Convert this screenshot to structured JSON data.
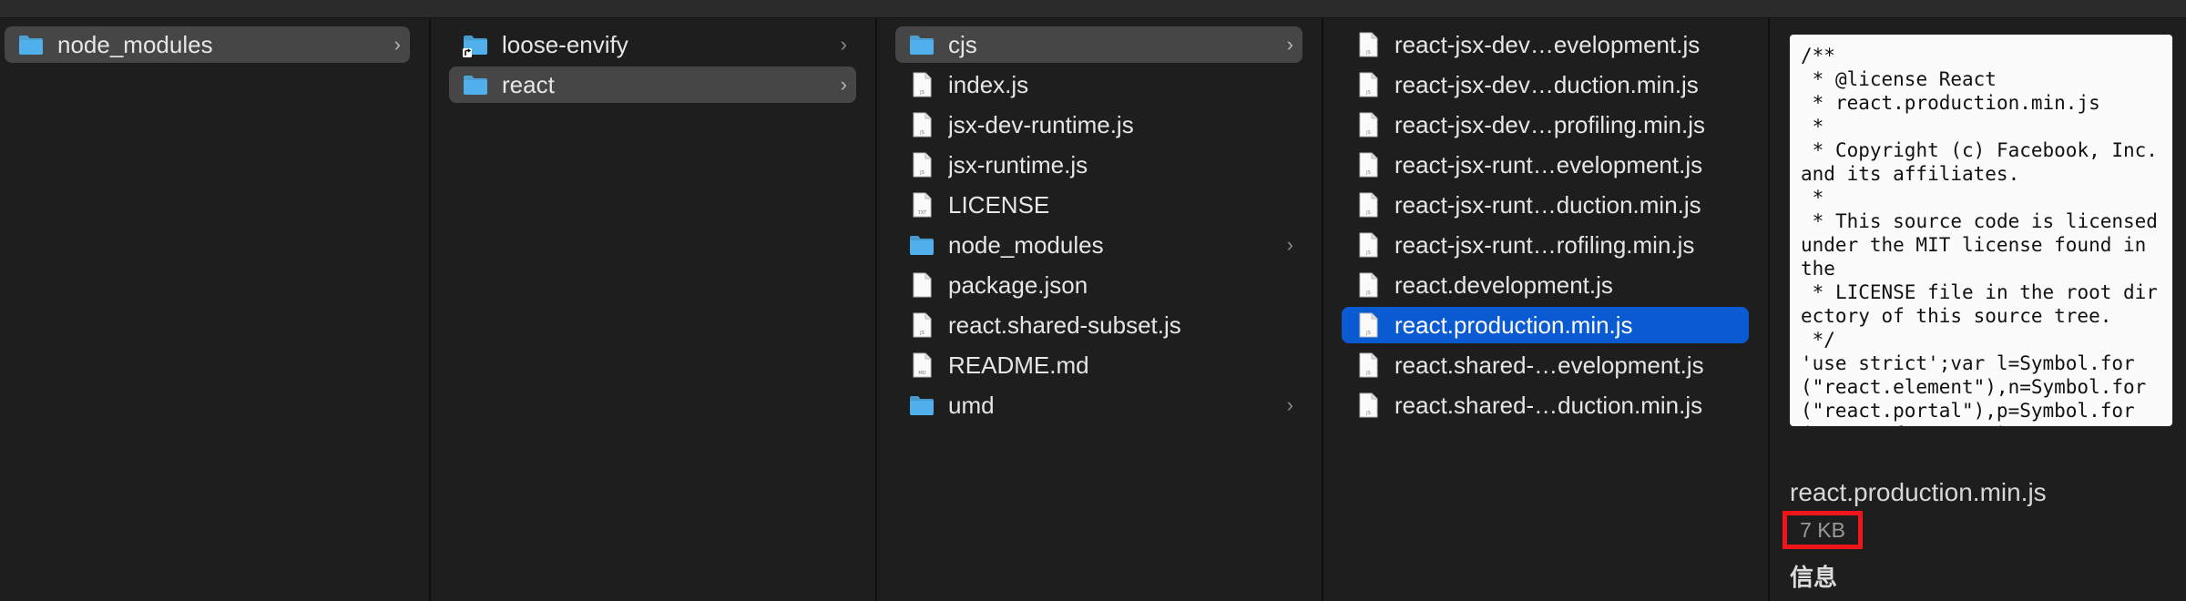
{
  "columns": [
    {
      "items": [
        {
          "label": "node_modules",
          "type": "folder",
          "chevron": true,
          "state": "inactive"
        }
      ]
    },
    {
      "items": [
        {
          "label": "loose-envify",
          "type": "folder-alias",
          "chevron": true,
          "state": ""
        },
        {
          "label": "react",
          "type": "folder",
          "chevron": true,
          "state": "inactive"
        }
      ]
    },
    {
      "items": [
        {
          "label": "cjs",
          "type": "folder",
          "chevron": true,
          "state": "inactive"
        },
        {
          "label": "index.js",
          "type": "js",
          "chevron": false,
          "state": ""
        },
        {
          "label": "jsx-dev-runtime.js",
          "type": "js",
          "chevron": false,
          "state": ""
        },
        {
          "label": "jsx-runtime.js",
          "type": "js",
          "chevron": false,
          "state": ""
        },
        {
          "label": "LICENSE",
          "type": "txt",
          "chevron": false,
          "state": ""
        },
        {
          "label": "node_modules",
          "type": "folder",
          "chevron": true,
          "state": ""
        },
        {
          "label": "package.json",
          "type": "blank",
          "chevron": false,
          "state": ""
        },
        {
          "label": "react.shared-subset.js",
          "type": "js",
          "chevron": false,
          "state": ""
        },
        {
          "label": "README.md",
          "type": "md",
          "chevron": false,
          "state": ""
        },
        {
          "label": "umd",
          "type": "folder",
          "chevron": true,
          "state": ""
        }
      ]
    },
    {
      "items": [
        {
          "label": "react-jsx-dev…evelopment.js",
          "type": "js",
          "chevron": false,
          "state": ""
        },
        {
          "label": "react-jsx-dev…duction.min.js",
          "type": "js",
          "chevron": false,
          "state": ""
        },
        {
          "label": "react-jsx-dev…profiling.min.js",
          "type": "js",
          "chevron": false,
          "state": ""
        },
        {
          "label": "react-jsx-runt…evelopment.js",
          "type": "js",
          "chevron": false,
          "state": ""
        },
        {
          "label": "react-jsx-runt…duction.min.js",
          "type": "js",
          "chevron": false,
          "state": ""
        },
        {
          "label": "react-jsx-runt…rofiling.min.js",
          "type": "js",
          "chevron": false,
          "state": ""
        },
        {
          "label": "react.development.js",
          "type": "js",
          "chevron": false,
          "state": ""
        },
        {
          "label": "react.production.min.js",
          "type": "js",
          "chevron": false,
          "state": "active"
        },
        {
          "label": "react.shared-…evelopment.js",
          "type": "js",
          "chevron": false,
          "state": ""
        },
        {
          "label": "react.shared-…duction.min.js",
          "type": "js",
          "chevron": false,
          "state": ""
        }
      ]
    }
  ],
  "preview": {
    "content": "/**\n * @license React\n * react.production.min.js\n *\n * Copyright (c) Facebook, Inc. and its affiliates.\n *\n * This source code is licensed under the MIT license found in the\n * LICENSE file in the root directory of this source tree.\n */\n'use strict';var l=Symbol.for(\"react.element\"),n=Symbol.for(\"react.portal\"),p=Symbol.for(\"react.fragment\"),",
    "file_name": "react.production.min.js",
    "file_size": "7 KB",
    "info_heading": "信息"
  },
  "colors": {
    "folder": "#4fb0ec",
    "selection_active": "#0a5bd2",
    "selection_inactive": "#464646",
    "highlight_box": "#f0151b"
  }
}
